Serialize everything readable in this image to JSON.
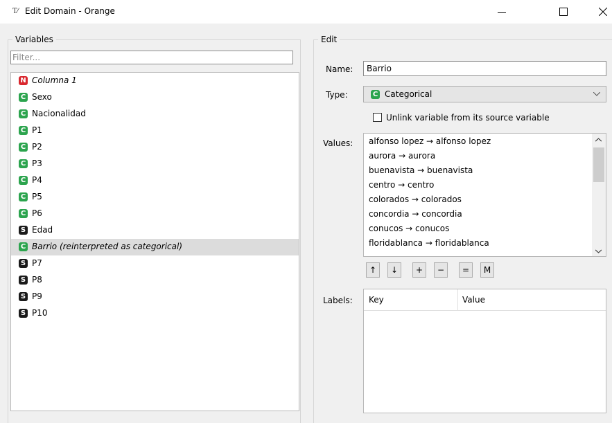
{
  "window": {
    "title": "Edit Domain - Orange",
    "app_icon": "T⁄"
  },
  "variables": {
    "legend": "Variables",
    "filter_placeholder": "Filter...",
    "items": [
      {
        "badge": "N",
        "label": "Columna 1",
        "italic": true
      },
      {
        "badge": "C",
        "label": "Sexo"
      },
      {
        "badge": "C",
        "label": "Nacionalidad"
      },
      {
        "badge": "C",
        "label": "P1"
      },
      {
        "badge": "C",
        "label": "P2"
      },
      {
        "badge": "C",
        "label": "P3"
      },
      {
        "badge": "C",
        "label": "P4"
      },
      {
        "badge": "C",
        "label": "P5"
      },
      {
        "badge": "C",
        "label": "P6"
      },
      {
        "badge": "S",
        "label": "Edad"
      },
      {
        "badge": "C",
        "label": "Barrio (reinterpreted as categorical)",
        "italic": true,
        "selected": true
      },
      {
        "badge": "S",
        "label": "P7"
      },
      {
        "badge": "S",
        "label": "P8"
      },
      {
        "badge": "S",
        "label": "P9"
      },
      {
        "badge": "S",
        "label": "P10"
      }
    ]
  },
  "edit": {
    "legend": "Edit",
    "name_label": "Name:",
    "name_value": "Barrio",
    "type_label": "Type:",
    "type_badge": "C",
    "type_value": "Categorical",
    "unlink_label": "Unlink variable from its source variable",
    "values_label": "Values:",
    "values": [
      "alfonso lopez → alfonso lopez",
      "aurora → aurora",
      "buenavista → buenavista",
      "centro → centro",
      "colorados → colorados",
      "concordia → concordia",
      "conucos → conucos",
      "floridablanca → floridablanca"
    ],
    "value_buttons": [
      "↑",
      "↓",
      "+",
      "−",
      "=",
      "M"
    ],
    "labels_label": "Labels:",
    "labels_columns": [
      "Key",
      "Value"
    ]
  },
  "colors": {
    "numeric": "#d9272e",
    "categorical": "#2ca44e",
    "string": "#1a1a1a",
    "selection": "#dcdcdc"
  }
}
